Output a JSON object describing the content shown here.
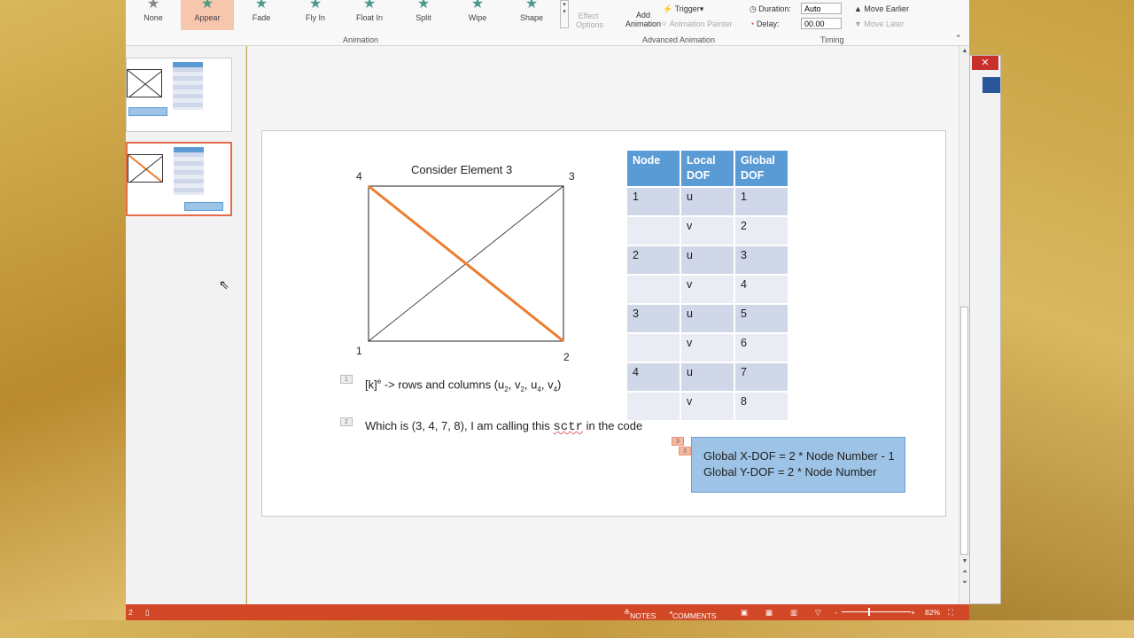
{
  "ribbon": {
    "effects": [
      {
        "label": "None",
        "selected": false
      },
      {
        "label": "Appear",
        "selected": true
      },
      {
        "label": "Fade",
        "selected": false
      },
      {
        "label": "Fly In",
        "selected": false
      },
      {
        "label": "Float In",
        "selected": false
      },
      {
        "label": "Split",
        "selected": false
      },
      {
        "label": "Wipe",
        "selected": false
      },
      {
        "label": "Shape",
        "selected": false
      }
    ],
    "effect_options_1": "Effect",
    "effect_options_2": "Options",
    "animation_group": "Animation",
    "add_animation_1": "Add",
    "add_animation_2": "Animation",
    "trigger": "Trigger",
    "animation_painter": "Animation Painter",
    "advanced_group": "Advanced Animation",
    "duration_label": "Duration:",
    "duration_value": "Auto",
    "delay_label": "Delay:",
    "delay_value": "00.00",
    "move_earlier": "Move Earlier",
    "move_later": "Move Later",
    "timing_group": "Timing"
  },
  "slide": {
    "title": "Consider Element 3",
    "nodes": {
      "n1": "1",
      "n2": "2",
      "n3": "3",
      "n4": "4"
    },
    "accent_color": "#ed7d31",
    "table": {
      "headers": [
        [
          "Node",
          ""
        ],
        [
          "Local",
          "DOF"
        ],
        [
          "Global",
          "DOF"
        ]
      ],
      "rows": [
        [
          "1",
          "u",
          "1"
        ],
        [
          "",
          "v",
          "2"
        ],
        [
          "2",
          "u",
          "3"
        ],
        [
          "",
          "v",
          "4"
        ],
        [
          "3",
          "u",
          "5"
        ],
        [
          "",
          "v",
          "6"
        ],
        [
          "4",
          "u",
          "7"
        ],
        [
          "",
          "v",
          "8"
        ]
      ]
    },
    "bullet1": {
      "num": "1",
      "pre": "[k]",
      "sup": "e",
      "text": " -> rows and columns (u",
      "s1": "2",
      ",  v": ", v",
      "s2": "2",
      "u": ", u",
      "s3": "4",
      "v": ", v",
      "s4": "4",
      "end": ")"
    },
    "bullet2": {
      "num": "2",
      "pre": "Which is (3, 4, 7, 8), I am calling this ",
      "code": "sctr",
      "post": " in the code"
    },
    "formula": {
      "num_a": "3",
      "num_b": "3",
      "line1": "Global X-DOF = 2 * Node Number - 1",
      "line2": "Global Y-DOF = 2 * Node Number"
    }
  },
  "status": {
    "slide": "2",
    "notes": "NOTES",
    "comments": "COMMENTS",
    "zoom": "82%"
  }
}
